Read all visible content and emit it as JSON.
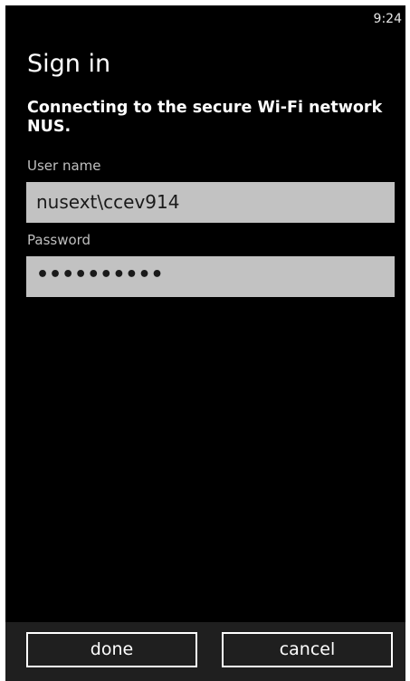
{
  "status_bar": {
    "time": "9:24"
  },
  "page": {
    "title": "Sign in",
    "subtitle": "Connecting to the secure Wi-Fi network NUS."
  },
  "form": {
    "username_label": "User name",
    "username_value": "nusext\\ccev914",
    "password_label": "Password",
    "password_value": "••••••••••"
  },
  "app_bar": {
    "done_label": "done",
    "cancel_label": "cancel"
  }
}
